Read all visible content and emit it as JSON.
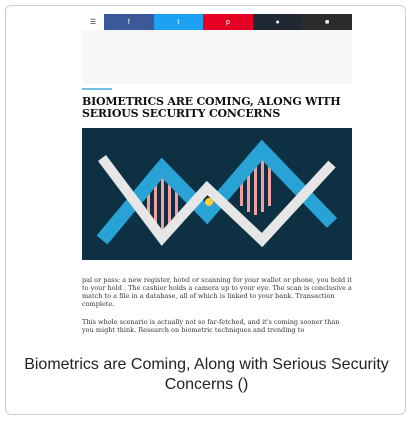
{
  "share_bar": {
    "menu_icon": "hamburger-icon",
    "facebook_label": "f",
    "twitter_label": "t",
    "pinterest_label": "p",
    "comment_icon": "comment-icon",
    "mail_icon": "mail-icon"
  },
  "article": {
    "title": "Biometrics Are Coming, Along With Serious Security Concerns",
    "byline": "",
    "paragraph1": "pal or pass: a new register, hotel or scanning for your wallet or phone, you hold it to your hold . The cashier holds a camera up to your eye. The scan is conclusive a match to a file in a database, all of which is linked to your bank. Transaction complete.",
    "paragraph2": "This whole scenario is actually not so far-fetched, and it's coming sooner than you might think. Research on biometric techniques and trending to"
  },
  "caption": "Biometrics are Coming, Along with Serious Security Concerns ()",
  "colors": {
    "facebook": "#3b5998",
    "twitter": "#1da1f2",
    "pinterest": "#e60023",
    "hero_bg": "#0d3142",
    "helix_blue": "#29a3d6",
    "helix_pink": "#f0a0a0"
  }
}
